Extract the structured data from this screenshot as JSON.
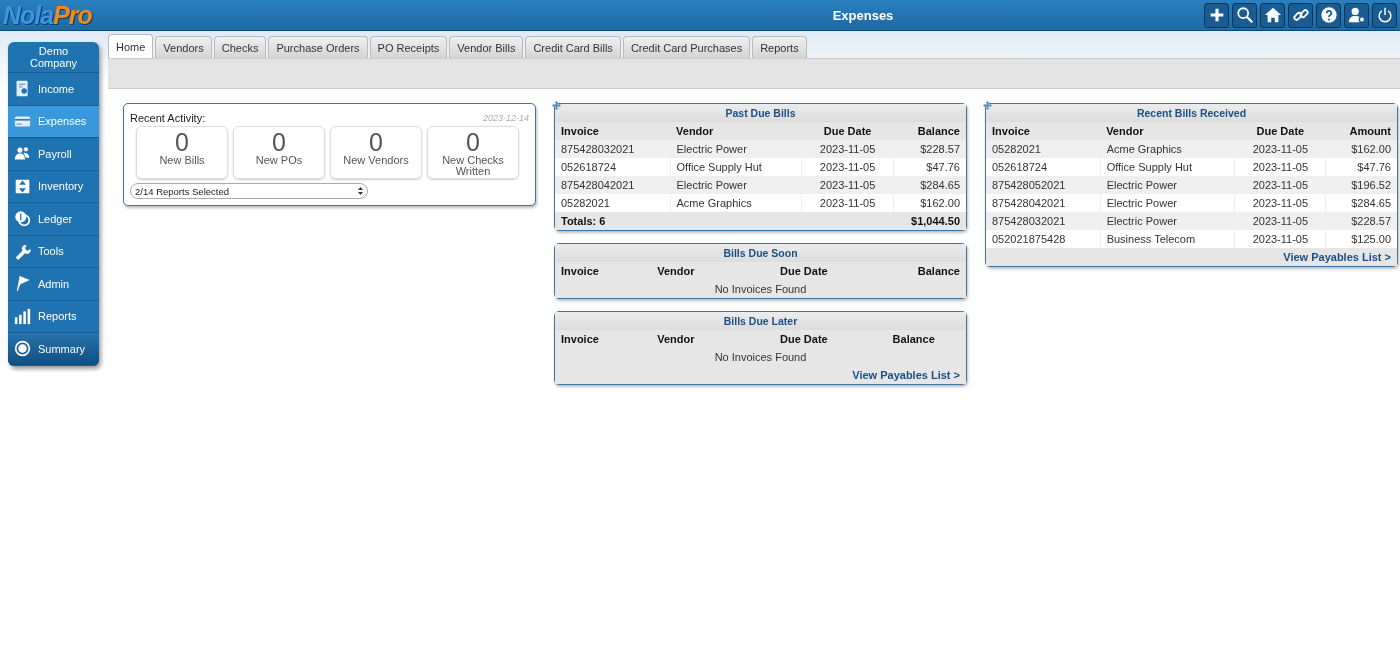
{
  "header": {
    "logo": [
      "Nola",
      "Pro"
    ],
    "title": "Expenses"
  },
  "tabs": [
    {
      "label": "Home",
      "selected": true
    },
    {
      "label": "Vendors",
      "selected": false
    },
    {
      "label": "Checks",
      "selected": false
    },
    {
      "label": "Purchase Orders",
      "selected": false
    },
    {
      "label": "PO Receipts",
      "selected": false
    },
    {
      "label": "Vendor Bills",
      "selected": false
    },
    {
      "label": "Credit Card Bills",
      "selected": false
    },
    {
      "label": "Credit Card Purchases",
      "selected": false
    },
    {
      "label": "Reports",
      "selected": false
    }
  ],
  "sidebar": {
    "company": "Demo Company",
    "items": [
      {
        "label": "Income",
        "selected": false
      },
      {
        "label": "Expenses",
        "selected": true
      },
      {
        "label": "Payroll",
        "selected": false
      },
      {
        "label": "Inventory",
        "selected": false
      },
      {
        "label": "Ledger",
        "selected": false
      },
      {
        "label": "Tools",
        "selected": false
      },
      {
        "label": "Admin",
        "selected": false
      },
      {
        "label": "Reports",
        "selected": false
      }
    ],
    "summary": {
      "label": "Summary"
    }
  },
  "recent_activity": {
    "title": "Recent Activity:",
    "date": "2023-12-14",
    "stats": [
      {
        "value": "0",
        "label": "New Bills"
      },
      {
        "value": "0",
        "label": "New POs"
      },
      {
        "value": "0",
        "label": "New Vendors"
      },
      {
        "value": "0",
        "label": "New Checks Written"
      }
    ],
    "select": {
      "value": "2/14 Reports Selected"
    }
  },
  "center_panels": [
    {
      "title": "Past Due Bills",
      "columns": [
        "Invoice",
        "Vendor",
        "Due Date",
        "Balance"
      ],
      "rows": [
        [
          "875428032021",
          "Electric Power",
          "2023-11-05",
          "$228.57"
        ],
        [
          "052618724",
          "Office Supply Hut",
          "2023-11-05",
          "$47.76"
        ],
        [
          "875428042021",
          "Electric Power",
          "2023-11-05",
          "$284.65"
        ],
        [
          "05282021",
          "Acme Graphics",
          "2023-11-05",
          "$162.00"
        ]
      ],
      "totals": {
        "label": "Totals: 6",
        "amount": "$1,044.50"
      }
    },
    {
      "title": "Bills Due Soon",
      "columns": [
        "Invoice",
        "Vendor",
        "Due Date",
        "Balance"
      ],
      "empty_message": "No Invoices Found"
    },
    {
      "title": "Bills Due Later",
      "columns": [
        "Invoice",
        "Vendor",
        "Due Date",
        "Balance"
      ],
      "empty_message": "No Invoices Found",
      "link": "View Payables List >"
    }
  ],
  "right_panels": [
    {
      "title": "Recent Bills Received",
      "columns": [
        "Invoice",
        "Vendor",
        "Due Date",
        "Amount"
      ],
      "rows": [
        [
          "05282021",
          "Acme Graphics",
          "2023-11-05",
          "$162.00"
        ],
        [
          "052618724",
          "Office Supply Hut",
          "2023-11-05",
          "$47.76"
        ],
        [
          "875428052021",
          "Electric Power",
          "2023-11-05",
          "$196.52"
        ],
        [
          "875428042021",
          "Electric Power",
          "2023-11-05",
          "$284.65"
        ],
        [
          "875428032021",
          "Electric Power",
          "2023-11-05",
          "$228.57"
        ],
        [
          "052021875428",
          "Business Telecom",
          "2023-11-05",
          "$125.00"
        ]
      ],
      "link": "View Payables List >"
    }
  ]
}
